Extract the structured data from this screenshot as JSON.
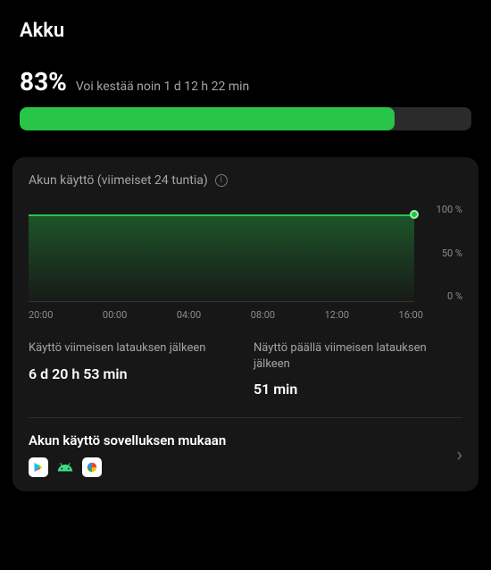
{
  "page_title": "Akku",
  "battery": {
    "percent_text": "83%",
    "percent_value": 83,
    "estimate_text": "Voi kestää noin 1 d 12 h 22 min"
  },
  "usage_card": {
    "title": "Akun käyttö (viimeiset 24 tuntia)",
    "info_icon": "i"
  },
  "chart_data": {
    "type": "area",
    "title": "Akun käyttö (viimeiset 24 tuntia)",
    "xlabel": "",
    "ylabel": "%",
    "ylim": [
      0,
      100
    ],
    "x_ticks": [
      "20:00",
      "00:00",
      "04:00",
      "08:00",
      "12:00",
      "16:00"
    ],
    "y_ticks": [
      "100 %",
      "50 %",
      "0 %"
    ],
    "series": [
      {
        "name": "battery",
        "values": [
          89,
          89,
          88,
          88,
          87,
          86,
          86,
          85,
          85,
          84,
          84,
          83,
          83
        ]
      }
    ],
    "current_marker": {
      "x_index": 12,
      "value": 83
    }
  },
  "stats": {
    "usage_since_charge": {
      "label": "Käyttö viimeisen latauksen jälkeen",
      "value": "6 d 20 h 53 min"
    },
    "screen_on_since_charge": {
      "label": "Näyttö päällä viimeisen latauksen jälkeen",
      "value": "51 min"
    }
  },
  "app_usage": {
    "title": "Akun käyttö sovelluksen mukaan",
    "icons": [
      "play-store-icon",
      "android-icon",
      "photos-icon"
    ]
  }
}
